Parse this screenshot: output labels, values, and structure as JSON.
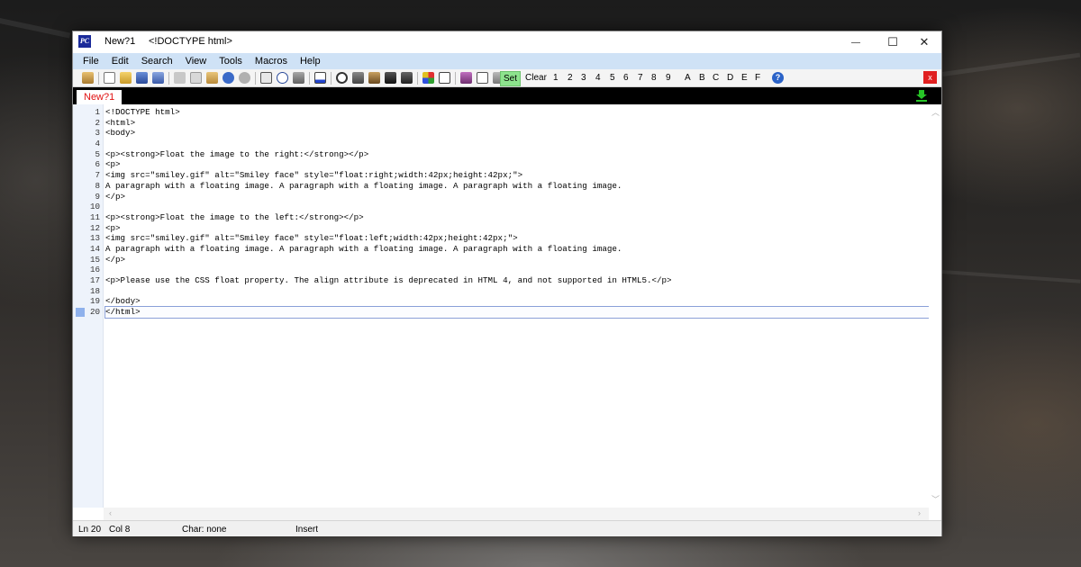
{
  "window": {
    "doc_name": "New?1",
    "title": "<!DOCTYPE html>",
    "controls": {
      "minimize": "—",
      "maximize": "☐",
      "close": "✕"
    }
  },
  "menu": [
    "File",
    "Edit",
    "Search",
    "View",
    "Tools",
    "Macros",
    "Help"
  ],
  "toolbar": {
    "set_label": "Set",
    "clear_label": "Clear",
    "numbers": [
      "1",
      "2",
      "3",
      "4",
      "5",
      "6",
      "7",
      "8",
      "9"
    ],
    "letters": [
      "A",
      "B",
      "C",
      "D",
      "E",
      "F"
    ],
    "close_label": "x",
    "help_label": "?"
  },
  "tabs": [
    {
      "label": "New?1",
      "active": true
    }
  ],
  "editor": {
    "lines": [
      {
        "n": "1",
        "text": "<!DOCTYPE html>"
      },
      {
        "n": "2",
        "text": "<html>"
      },
      {
        "n": "3",
        "text": "<body>"
      },
      {
        "n": "4",
        "text": ""
      },
      {
        "n": "5",
        "text": "<p><strong>Float the image to the right:</strong></p>"
      },
      {
        "n": "6",
        "text": "<p>"
      },
      {
        "n": "7",
        "text": "<img src=\"smiley.gif\" alt=\"Smiley face\" style=\"float:right;width:42px;height:42px;\">"
      },
      {
        "n": "8",
        "text": "A paragraph with a floating image. A paragraph with a floating image. A paragraph with a floating image."
      },
      {
        "n": "9",
        "text": "</p>"
      },
      {
        "n": "10",
        "text": ""
      },
      {
        "n": "11",
        "text": "<p><strong>Float the image to the left:</strong></p>"
      },
      {
        "n": "12",
        "text": "<p>"
      },
      {
        "n": "13",
        "text": "<img src=\"smiley.gif\" alt=\"Smiley face\" style=\"float:left;width:42px;height:42px;\">"
      },
      {
        "n": "14",
        "text": "A paragraph with a floating image. A paragraph with a floating image. A paragraph with a floating image."
      },
      {
        "n": "15",
        "text": "</p>"
      },
      {
        "n": "16",
        "text": ""
      },
      {
        "n": "17",
        "text": "<p>Please use the CSS float property. The align attribute is deprecated in HTML 4, and not supported in HTML5.</p>"
      },
      {
        "n": "18",
        "text": ""
      },
      {
        "n": "19",
        "text": "</body>"
      },
      {
        "n": "20",
        "text": "</html>"
      }
    ],
    "current_line": 20
  },
  "status": {
    "line": "Ln 20",
    "col": "Col 8",
    "char": "Char: none",
    "mode": "Insert"
  },
  "colors": {
    "menubar": "#cfe2f6",
    "tab_text": "#e01010",
    "set_button": "#8de38d",
    "close_button": "#e02020",
    "current_line_marker": "#8fb1ec"
  }
}
